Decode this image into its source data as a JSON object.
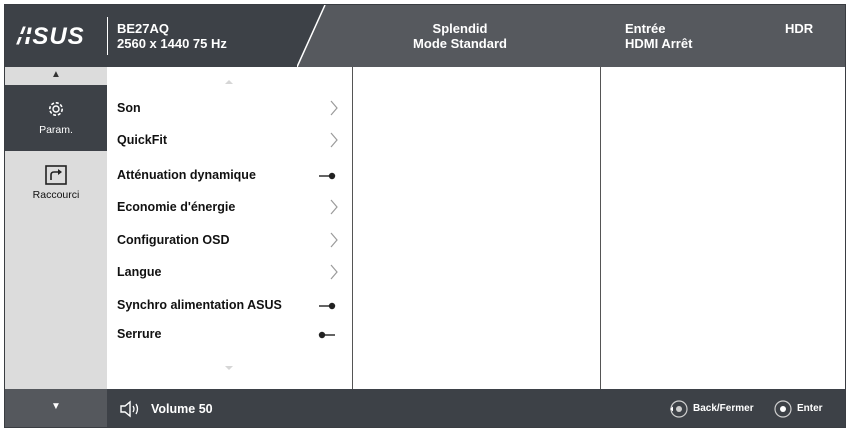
{
  "header": {
    "brand": "ASUS",
    "model": "BE27AQ",
    "resolution": "2560 x 1440 75 Hz",
    "splendid_label": "Splendid",
    "splendid_mode": "Mode Standard",
    "input_label": "Entrée",
    "input_value": "HDMI Arrêt",
    "hdr_label": "HDR"
  },
  "sidebar": {
    "items": [
      {
        "label": "Param.",
        "icon": "gear-icon",
        "active": true
      },
      {
        "label": "Raccourci",
        "icon": "shortcut-icon",
        "active": false
      }
    ]
  },
  "menu": {
    "items": [
      {
        "label": "Son",
        "control": "chevron"
      },
      {
        "label": "QuickFit",
        "control": "chevron"
      },
      {
        "label": "Atténuation dynamique",
        "control": "toggle-on"
      },
      {
        "label": "Economie d'énergie",
        "control": "chevron"
      },
      {
        "label": "Configuration OSD",
        "control": "chevron"
      },
      {
        "label": "Langue",
        "control": "chevron"
      },
      {
        "label": "Synchro alimentation ASUS",
        "control": "toggle-on"
      },
      {
        "label": "Serrure",
        "control": "toggle-off"
      }
    ]
  },
  "footer": {
    "volume_label": "Volume 50",
    "back_label": "Back/Fermer",
    "enter_label": "Enter"
  },
  "colors": {
    "header_dark": "#3d4147",
    "header_light": "#56595e",
    "sidebar_bg": "#dcdcdc",
    "text": "#111111"
  }
}
